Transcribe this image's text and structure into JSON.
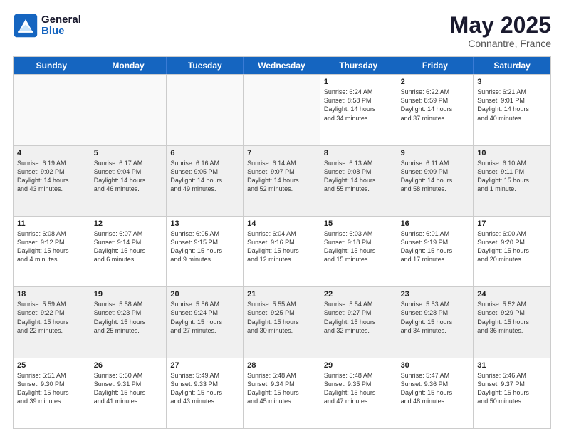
{
  "logo": {
    "line1": "General",
    "line2": "Blue"
  },
  "title": "May 2025",
  "location": "Connantre, France",
  "days": [
    "Sunday",
    "Monday",
    "Tuesday",
    "Wednesday",
    "Thursday",
    "Friday",
    "Saturday"
  ],
  "weeks": [
    [
      {
        "day": "",
        "info": ""
      },
      {
        "day": "",
        "info": ""
      },
      {
        "day": "",
        "info": ""
      },
      {
        "day": "",
        "info": ""
      },
      {
        "day": "1",
        "info": "Sunrise: 6:24 AM\nSunset: 8:58 PM\nDaylight: 14 hours\nand 34 minutes."
      },
      {
        "day": "2",
        "info": "Sunrise: 6:22 AM\nSunset: 8:59 PM\nDaylight: 14 hours\nand 37 minutes."
      },
      {
        "day": "3",
        "info": "Sunrise: 6:21 AM\nSunset: 9:01 PM\nDaylight: 14 hours\nand 40 minutes."
      }
    ],
    [
      {
        "day": "4",
        "info": "Sunrise: 6:19 AM\nSunset: 9:02 PM\nDaylight: 14 hours\nand 43 minutes."
      },
      {
        "day": "5",
        "info": "Sunrise: 6:17 AM\nSunset: 9:04 PM\nDaylight: 14 hours\nand 46 minutes."
      },
      {
        "day": "6",
        "info": "Sunrise: 6:16 AM\nSunset: 9:05 PM\nDaylight: 14 hours\nand 49 minutes."
      },
      {
        "day": "7",
        "info": "Sunrise: 6:14 AM\nSunset: 9:07 PM\nDaylight: 14 hours\nand 52 minutes."
      },
      {
        "day": "8",
        "info": "Sunrise: 6:13 AM\nSunset: 9:08 PM\nDaylight: 14 hours\nand 55 minutes."
      },
      {
        "day": "9",
        "info": "Sunrise: 6:11 AM\nSunset: 9:09 PM\nDaylight: 14 hours\nand 58 minutes."
      },
      {
        "day": "10",
        "info": "Sunrise: 6:10 AM\nSunset: 9:11 PM\nDaylight: 15 hours\nand 1 minute."
      }
    ],
    [
      {
        "day": "11",
        "info": "Sunrise: 6:08 AM\nSunset: 9:12 PM\nDaylight: 15 hours\nand 4 minutes."
      },
      {
        "day": "12",
        "info": "Sunrise: 6:07 AM\nSunset: 9:14 PM\nDaylight: 15 hours\nand 6 minutes."
      },
      {
        "day": "13",
        "info": "Sunrise: 6:05 AM\nSunset: 9:15 PM\nDaylight: 15 hours\nand 9 minutes."
      },
      {
        "day": "14",
        "info": "Sunrise: 6:04 AM\nSunset: 9:16 PM\nDaylight: 15 hours\nand 12 minutes."
      },
      {
        "day": "15",
        "info": "Sunrise: 6:03 AM\nSunset: 9:18 PM\nDaylight: 15 hours\nand 15 minutes."
      },
      {
        "day": "16",
        "info": "Sunrise: 6:01 AM\nSunset: 9:19 PM\nDaylight: 15 hours\nand 17 minutes."
      },
      {
        "day": "17",
        "info": "Sunrise: 6:00 AM\nSunset: 9:20 PM\nDaylight: 15 hours\nand 20 minutes."
      }
    ],
    [
      {
        "day": "18",
        "info": "Sunrise: 5:59 AM\nSunset: 9:22 PM\nDaylight: 15 hours\nand 22 minutes."
      },
      {
        "day": "19",
        "info": "Sunrise: 5:58 AM\nSunset: 9:23 PM\nDaylight: 15 hours\nand 25 minutes."
      },
      {
        "day": "20",
        "info": "Sunrise: 5:56 AM\nSunset: 9:24 PM\nDaylight: 15 hours\nand 27 minutes."
      },
      {
        "day": "21",
        "info": "Sunrise: 5:55 AM\nSunset: 9:25 PM\nDaylight: 15 hours\nand 30 minutes."
      },
      {
        "day": "22",
        "info": "Sunrise: 5:54 AM\nSunset: 9:27 PM\nDaylight: 15 hours\nand 32 minutes."
      },
      {
        "day": "23",
        "info": "Sunrise: 5:53 AM\nSunset: 9:28 PM\nDaylight: 15 hours\nand 34 minutes."
      },
      {
        "day": "24",
        "info": "Sunrise: 5:52 AM\nSunset: 9:29 PM\nDaylight: 15 hours\nand 36 minutes."
      }
    ],
    [
      {
        "day": "25",
        "info": "Sunrise: 5:51 AM\nSunset: 9:30 PM\nDaylight: 15 hours\nand 39 minutes."
      },
      {
        "day": "26",
        "info": "Sunrise: 5:50 AM\nSunset: 9:31 PM\nDaylight: 15 hours\nand 41 minutes."
      },
      {
        "day": "27",
        "info": "Sunrise: 5:49 AM\nSunset: 9:33 PM\nDaylight: 15 hours\nand 43 minutes."
      },
      {
        "day": "28",
        "info": "Sunrise: 5:48 AM\nSunset: 9:34 PM\nDaylight: 15 hours\nand 45 minutes."
      },
      {
        "day": "29",
        "info": "Sunrise: 5:48 AM\nSunset: 9:35 PM\nDaylight: 15 hours\nand 47 minutes."
      },
      {
        "day": "30",
        "info": "Sunrise: 5:47 AM\nSunset: 9:36 PM\nDaylight: 15 hours\nand 48 minutes."
      },
      {
        "day": "31",
        "info": "Sunrise: 5:46 AM\nSunset: 9:37 PM\nDaylight: 15 hours\nand 50 minutes."
      }
    ]
  ]
}
